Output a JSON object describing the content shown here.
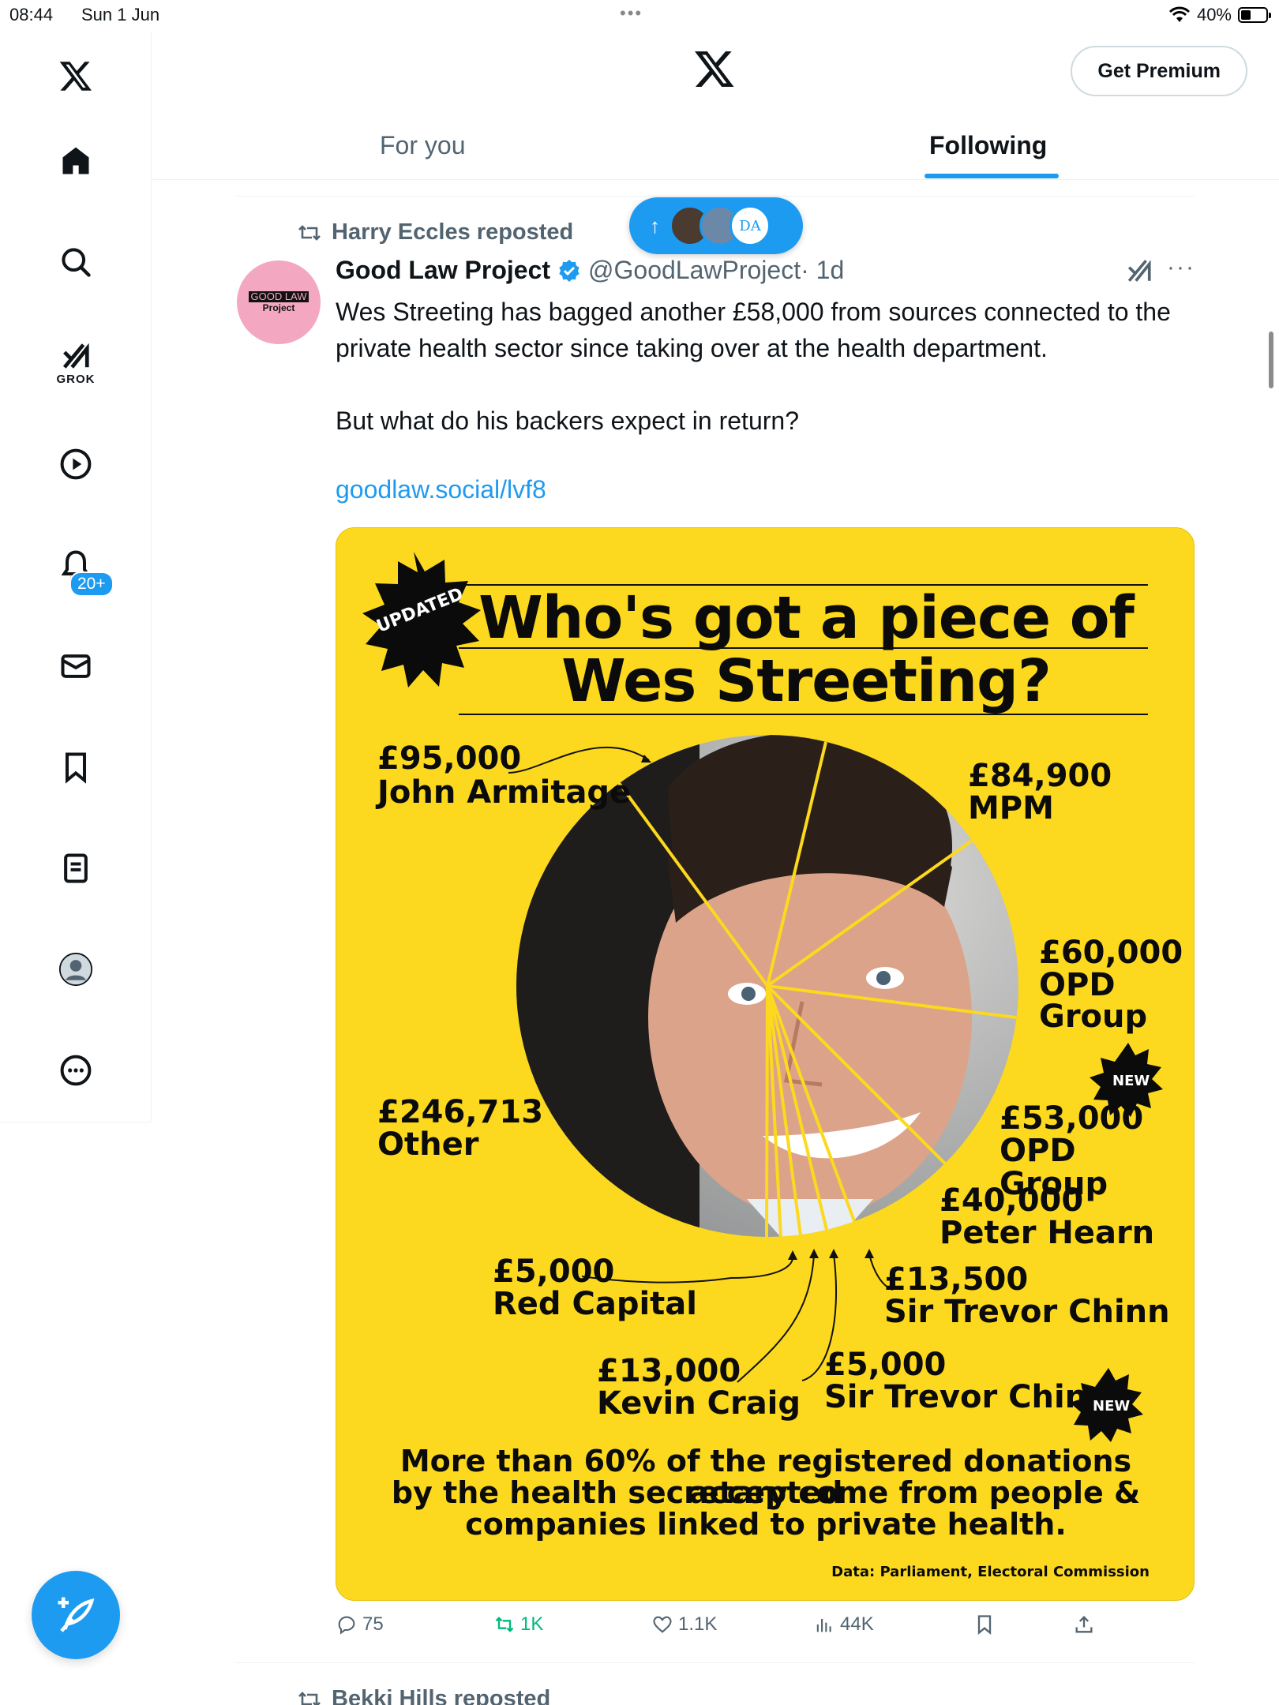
{
  "status_bar": {
    "time": "08:44",
    "date": "Sun 1 Jun",
    "battery": "40%"
  },
  "icons": {
    "x_logo": "x-logo-icon",
    "home": "home-icon",
    "search": "search-icon",
    "grok": "grok-icon",
    "video": "play-icon",
    "notifications": "bell-icon",
    "messages": "mail-icon",
    "bookmarks": "bookmark-icon",
    "lists": "list-icon",
    "profile": "profile-icon",
    "more": "more-circle-icon",
    "compose": "compose-icon"
  },
  "nav": {
    "grok_label": "GROK",
    "notifications_badge": "20+"
  },
  "header": {
    "get_premium": "Get Premium",
    "tabs": [
      {
        "label": "For you"
      },
      {
        "label": "Following"
      }
    ],
    "active_tab": "Following"
  },
  "post": {
    "reposted_by": "Harry Eccles reposted",
    "avatar_line1": "GOOD LAW",
    "avatar_line2": "Project",
    "author_name": "Good Law Project",
    "handle": "@GoodLawProject",
    "time": "· 1d",
    "text_p1": "Wes Streeting has bagged another £58,000 from sources connected to the private health sector since taking over at the health department.",
    "text_p2": "But what do his backers expect in return?",
    "link": "goodlaw.social/lvf8",
    "image": {
      "badge": "UPDATED",
      "headline_line1": "Who's got a piece of",
      "headline_line2": "Wes Streeting?",
      "donations": [
        {
          "amount": "£95,000",
          "label": "John Armitage"
        },
        {
          "amount": "£84,900",
          "label": "MPM"
        },
        {
          "amount": "£60,000",
          "label_lines": [
            "OPD",
            "Group"
          ]
        },
        {
          "amount": "£53,000",
          "label": "OPD Group",
          "tag": "NEW"
        },
        {
          "amount": "£40,000",
          "label": "Peter Hearn"
        },
        {
          "amount": "£13,500",
          "label": "Sir Trevor Chinn"
        },
        {
          "amount": "£5,000",
          "label": "Sir Trevor Chinn",
          "tag": "NEW"
        },
        {
          "amount": "£13,000",
          "label": "Kevin Craig"
        },
        {
          "amount": "£5,000",
          "label": "Red Capital"
        },
        {
          "amount": "£246,713",
          "label": "Other"
        }
      ],
      "footer_lines": [
        "More than 60% of the registered donations accepted",
        "by the health secretary come from people &",
        "companies linked to private health."
      ],
      "source": "Data: Parliament, Electoral Commission"
    },
    "stats": {
      "replies": "75",
      "reposts": "1K",
      "likes": "1.1K",
      "views": "44K"
    }
  },
  "next_post": {
    "reposted_by": "Bekki Hills reposted"
  }
}
